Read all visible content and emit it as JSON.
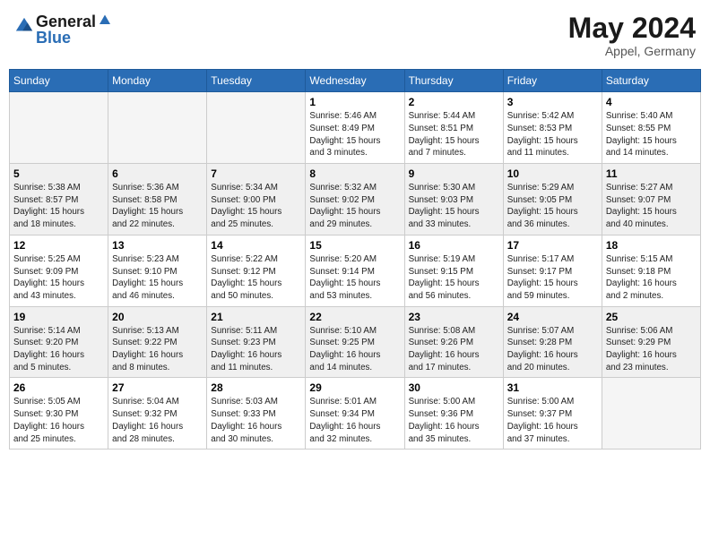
{
  "header": {
    "logo_line1": "General",
    "logo_line2": "Blue",
    "month": "May 2024",
    "location": "Appel, Germany"
  },
  "columns": [
    "Sunday",
    "Monday",
    "Tuesday",
    "Wednesday",
    "Thursday",
    "Friday",
    "Saturday"
  ],
  "weeks": [
    [
      {
        "day": "",
        "info": ""
      },
      {
        "day": "",
        "info": ""
      },
      {
        "day": "",
        "info": ""
      },
      {
        "day": "1",
        "info": "Sunrise: 5:46 AM\nSunset: 8:49 PM\nDaylight: 15 hours\nand 3 minutes."
      },
      {
        "day": "2",
        "info": "Sunrise: 5:44 AM\nSunset: 8:51 PM\nDaylight: 15 hours\nand 7 minutes."
      },
      {
        "day": "3",
        "info": "Sunrise: 5:42 AM\nSunset: 8:53 PM\nDaylight: 15 hours\nand 11 minutes."
      },
      {
        "day": "4",
        "info": "Sunrise: 5:40 AM\nSunset: 8:55 PM\nDaylight: 15 hours\nand 14 minutes."
      }
    ],
    [
      {
        "day": "5",
        "info": "Sunrise: 5:38 AM\nSunset: 8:57 PM\nDaylight: 15 hours\nand 18 minutes."
      },
      {
        "day": "6",
        "info": "Sunrise: 5:36 AM\nSunset: 8:58 PM\nDaylight: 15 hours\nand 22 minutes."
      },
      {
        "day": "7",
        "info": "Sunrise: 5:34 AM\nSunset: 9:00 PM\nDaylight: 15 hours\nand 25 minutes."
      },
      {
        "day": "8",
        "info": "Sunrise: 5:32 AM\nSunset: 9:02 PM\nDaylight: 15 hours\nand 29 minutes."
      },
      {
        "day": "9",
        "info": "Sunrise: 5:30 AM\nSunset: 9:03 PM\nDaylight: 15 hours\nand 33 minutes."
      },
      {
        "day": "10",
        "info": "Sunrise: 5:29 AM\nSunset: 9:05 PM\nDaylight: 15 hours\nand 36 minutes."
      },
      {
        "day": "11",
        "info": "Sunrise: 5:27 AM\nSunset: 9:07 PM\nDaylight: 15 hours\nand 40 minutes."
      }
    ],
    [
      {
        "day": "12",
        "info": "Sunrise: 5:25 AM\nSunset: 9:09 PM\nDaylight: 15 hours\nand 43 minutes."
      },
      {
        "day": "13",
        "info": "Sunrise: 5:23 AM\nSunset: 9:10 PM\nDaylight: 15 hours\nand 46 minutes."
      },
      {
        "day": "14",
        "info": "Sunrise: 5:22 AM\nSunset: 9:12 PM\nDaylight: 15 hours\nand 50 minutes."
      },
      {
        "day": "15",
        "info": "Sunrise: 5:20 AM\nSunset: 9:14 PM\nDaylight: 15 hours\nand 53 minutes."
      },
      {
        "day": "16",
        "info": "Sunrise: 5:19 AM\nSunset: 9:15 PM\nDaylight: 15 hours\nand 56 minutes."
      },
      {
        "day": "17",
        "info": "Sunrise: 5:17 AM\nSunset: 9:17 PM\nDaylight: 15 hours\nand 59 minutes."
      },
      {
        "day": "18",
        "info": "Sunrise: 5:15 AM\nSunset: 9:18 PM\nDaylight: 16 hours\nand 2 minutes."
      }
    ],
    [
      {
        "day": "19",
        "info": "Sunrise: 5:14 AM\nSunset: 9:20 PM\nDaylight: 16 hours\nand 5 minutes."
      },
      {
        "day": "20",
        "info": "Sunrise: 5:13 AM\nSunset: 9:22 PM\nDaylight: 16 hours\nand 8 minutes."
      },
      {
        "day": "21",
        "info": "Sunrise: 5:11 AM\nSunset: 9:23 PM\nDaylight: 16 hours\nand 11 minutes."
      },
      {
        "day": "22",
        "info": "Sunrise: 5:10 AM\nSunset: 9:25 PM\nDaylight: 16 hours\nand 14 minutes."
      },
      {
        "day": "23",
        "info": "Sunrise: 5:08 AM\nSunset: 9:26 PM\nDaylight: 16 hours\nand 17 minutes."
      },
      {
        "day": "24",
        "info": "Sunrise: 5:07 AM\nSunset: 9:28 PM\nDaylight: 16 hours\nand 20 minutes."
      },
      {
        "day": "25",
        "info": "Sunrise: 5:06 AM\nSunset: 9:29 PM\nDaylight: 16 hours\nand 23 minutes."
      }
    ],
    [
      {
        "day": "26",
        "info": "Sunrise: 5:05 AM\nSunset: 9:30 PM\nDaylight: 16 hours\nand 25 minutes."
      },
      {
        "day": "27",
        "info": "Sunrise: 5:04 AM\nSunset: 9:32 PM\nDaylight: 16 hours\nand 28 minutes."
      },
      {
        "day": "28",
        "info": "Sunrise: 5:03 AM\nSunset: 9:33 PM\nDaylight: 16 hours\nand 30 minutes."
      },
      {
        "day": "29",
        "info": "Sunrise: 5:01 AM\nSunset: 9:34 PM\nDaylight: 16 hours\nand 32 minutes."
      },
      {
        "day": "30",
        "info": "Sunrise: 5:00 AM\nSunset: 9:36 PM\nDaylight: 16 hours\nand 35 minutes."
      },
      {
        "day": "31",
        "info": "Sunrise: 5:00 AM\nSunset: 9:37 PM\nDaylight: 16 hours\nand 37 minutes."
      },
      {
        "day": "",
        "info": ""
      }
    ]
  ]
}
